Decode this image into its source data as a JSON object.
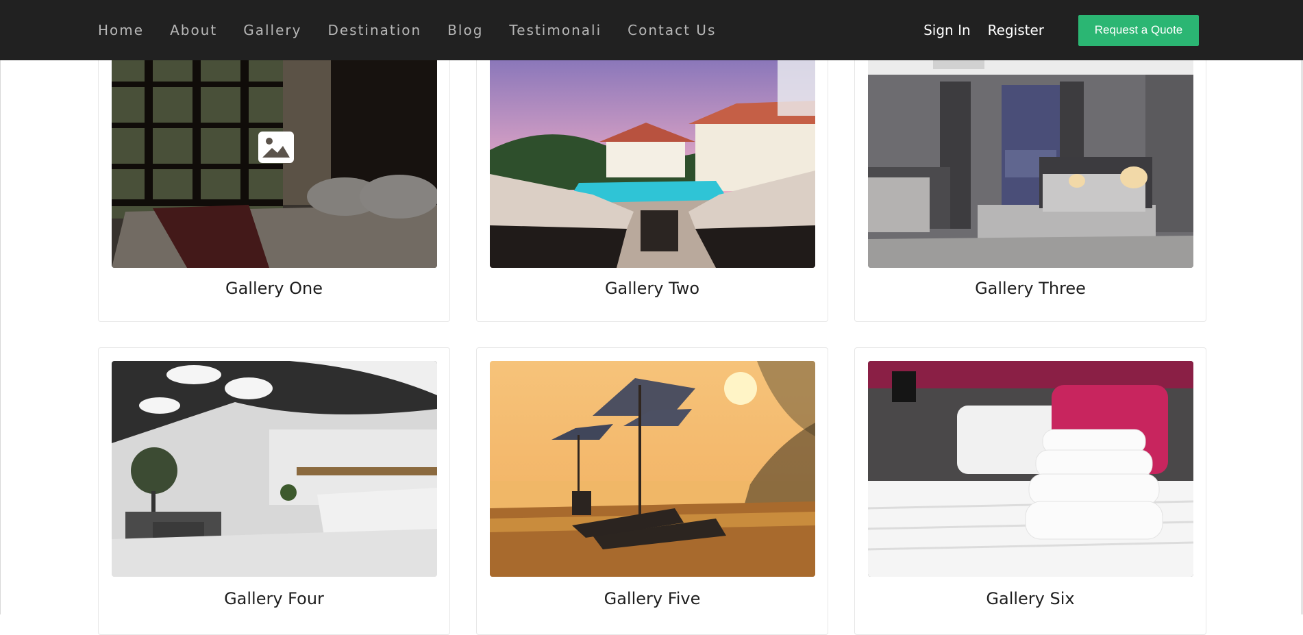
{
  "nav": {
    "links": [
      "Home",
      "About",
      "Gallery",
      "Destination",
      "Blog",
      "Testimonali",
      "Contact Us"
    ],
    "sign_in": "Sign In",
    "register": "Register",
    "quote_button": "Request a Quote"
  },
  "gallery": {
    "items": [
      {
        "title": "Gallery One",
        "icon": "image-icon",
        "hovered": true
      },
      {
        "title": "Gallery Two"
      },
      {
        "title": "Gallery Three"
      },
      {
        "title": "Gallery Four"
      },
      {
        "title": "Gallery Five"
      },
      {
        "title": "Gallery Six"
      }
    ]
  },
  "colors": {
    "nav_bg": "#212121",
    "nav_text": "#b7b7b7",
    "accent": "#2bb673",
    "card_border": "#e7e7e7"
  }
}
